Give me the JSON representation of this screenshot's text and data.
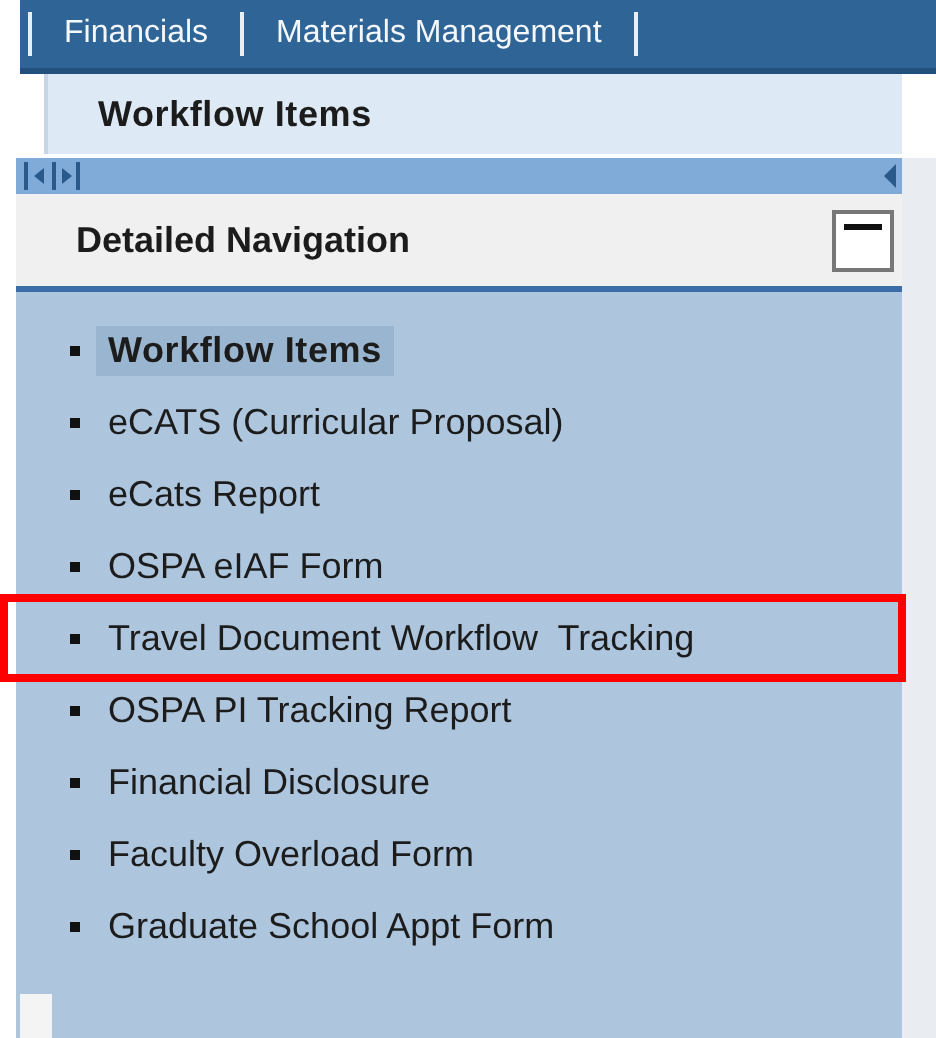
{
  "top_tabs": [
    {
      "label": "Financials",
      "selected": false
    },
    {
      "label": "Materials Management",
      "selected": false
    }
  ],
  "page_title": "Workflow Items",
  "panel": {
    "title": "Detailed Navigation",
    "expanded": true
  },
  "nav_items": [
    {
      "label": "Workflow Items",
      "selected": true,
      "highlighted": false
    },
    {
      "label": "eCATS (Curricular Proposal)",
      "selected": false,
      "highlighted": false
    },
    {
      "label": "eCats Report",
      "selected": false,
      "highlighted": false
    },
    {
      "label": "OSPA eIAF Form",
      "selected": false,
      "highlighted": false
    },
    {
      "label": "Travel Document Workflow  Tracking",
      "selected": false,
      "highlighted": true
    },
    {
      "label": "OSPA PI Tracking Report",
      "selected": false,
      "highlighted": false
    },
    {
      "label": "Financial Disclosure",
      "selected": false,
      "highlighted": false
    },
    {
      "label": "Faculty Overload Form",
      "selected": false,
      "highlighted": false
    },
    {
      "label": "Graduate School Appt Form",
      "selected": false,
      "highlighted": false
    }
  ]
}
